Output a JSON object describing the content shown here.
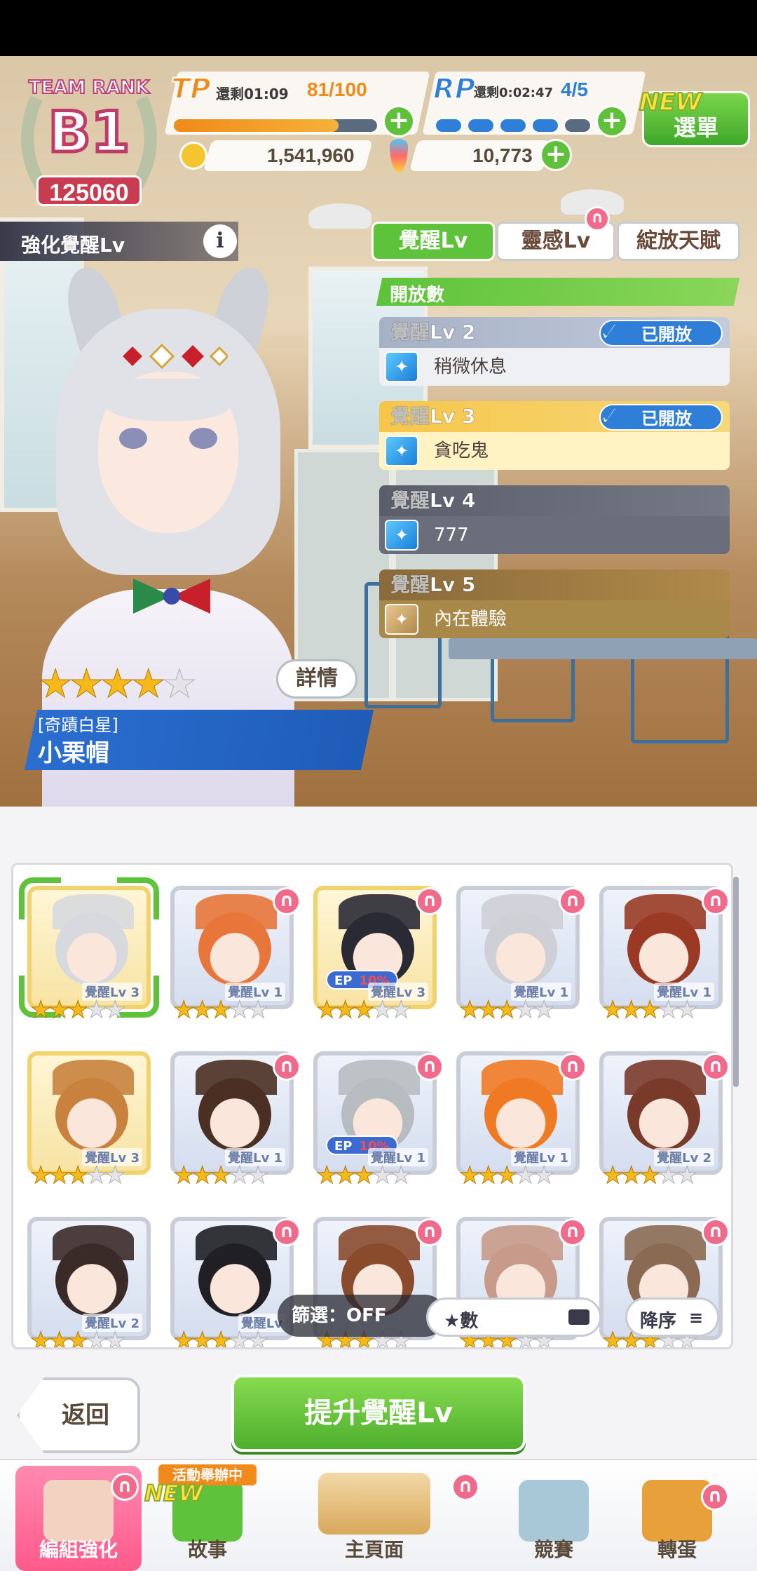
{
  "header": {
    "team_rank_label": "TEAM RANK",
    "rank_grade": "B1",
    "rank_points": "125060",
    "tp": {
      "label": "TP",
      "timer": "還剩01:09",
      "value": "81/100",
      "fill": 0.81
    },
    "rp": {
      "label": "RP",
      "timer": "還剩0:02:47",
      "value": "4/5",
      "filled_pips": 4,
      "total_pips": 5
    },
    "menu_new": "NEW",
    "menu_label": "選單",
    "coins": "1,541,960",
    "carrots": "10,773",
    "plus": "+"
  },
  "left_panel": {
    "title": "強化覺醒Lv",
    "info": "i",
    "details_button": "詳情",
    "character_title": "[奇蹟白星]",
    "character_name": "小栗帽",
    "stars": {
      "filled": 4,
      "total": 5
    }
  },
  "tabs": [
    {
      "label": "覺醒Lv",
      "active": true
    },
    {
      "label": "靈感Lv",
      "active": false
    },
    {
      "label": "綻放天賦",
      "active": false
    }
  ],
  "unlock_header": "開放數",
  "awakening_levels": [
    {
      "level": "覺醒Lv 2",
      "skill": "稍微休息",
      "status": "已開放",
      "style": "grey"
    },
    {
      "level": "覺醒Lv 3",
      "skill": "貪吃鬼",
      "status": "已開放",
      "style": "gold"
    },
    {
      "level": "覺醒Lv 4",
      "skill": "777",
      "status": "",
      "style": "dark"
    },
    {
      "level": "覺醒Lv 5",
      "skill": "內在體驗",
      "status": "",
      "style": "brown"
    }
  ],
  "roster": [
    {
      "label": "覺醒Lv 3",
      "stars": 3,
      "ep": "",
      "selected": true,
      "frame": "gold",
      "horseshoe": false,
      "hair": "#d7d9de"
    },
    {
      "label": "覺醒Lv 1",
      "stars": 3,
      "ep": "",
      "selected": false,
      "frame": "silver",
      "horseshoe": true,
      "hair": "#e8763a"
    },
    {
      "label": "覺醒Lv 3",
      "stars": 3,
      "ep": "10%",
      "selected": false,
      "frame": "gold",
      "horseshoe": true,
      "hair": "#2a2a35"
    },
    {
      "label": "覺醒Lv 1",
      "stars": 3,
      "ep": "",
      "selected": false,
      "frame": "silver",
      "horseshoe": true,
      "hair": "#cfcfd6"
    },
    {
      "label": "覺醒Lv 1",
      "stars": 3,
      "ep": "",
      "selected": false,
      "frame": "silver",
      "horseshoe": true,
      "hair": "#9a3a25"
    },
    {
      "label": "覺醒Lv 3",
      "stars": 3,
      "ep": "",
      "selected": false,
      "frame": "gold",
      "horseshoe": false,
      "hair": "#c8823e"
    },
    {
      "label": "覺醒Lv 1",
      "stars": 3,
      "ep": "",
      "selected": false,
      "frame": "silver",
      "horseshoe": true,
      "hair": "#4a2f22"
    },
    {
      "label": "覺醒Lv 1",
      "stars": 3,
      "ep": "10%",
      "selected": false,
      "frame": "silver",
      "horseshoe": true,
      "hair": "#b7bcc0"
    },
    {
      "label": "覺醒Lv 1",
      "stars": 3,
      "ep": "",
      "selected": false,
      "frame": "silver",
      "horseshoe": true,
      "hair": "#f07a24"
    },
    {
      "label": "覺醒Lv 2",
      "stars": 3,
      "ep": "",
      "selected": false,
      "frame": "silver",
      "horseshoe": true,
      "hair": "#7a3a2a"
    },
    {
      "label": "覺醒Lv 2",
      "stars": 3,
      "ep": "",
      "selected": false,
      "frame": "silver",
      "horseshoe": false,
      "hair": "#3a2a28"
    },
    {
      "label": "覺醒Lv",
      "stars": 3,
      "ep": "",
      "selected": false,
      "frame": "silver",
      "horseshoe": true,
      "hair": "#1f1f24"
    },
    {
      "label": "",
      "stars": 3,
      "ep": "",
      "selected": false,
      "frame": "silver",
      "horseshoe": true,
      "hair": "#8a4a2c"
    },
    {
      "label": "",
      "stars": 3,
      "ep": "",
      "selected": false,
      "frame": "silver",
      "horseshoe": true,
      "hair": "#c79a8a"
    },
    {
      "label": "",
      "stars": 3,
      "ep": "",
      "selected": false,
      "frame": "silver",
      "horseshoe": true,
      "hair": "#8a6a52"
    }
  ],
  "filter": {
    "label": "篩選：OFF",
    "sort_key": "★數",
    "order": "降序"
  },
  "buttons": {
    "back": "返回",
    "upgrade": "提升覺醒Lv"
  },
  "bottom_nav": [
    {
      "label": "編組強化",
      "active": true,
      "badge": ""
    },
    {
      "label": "故事",
      "active": false,
      "badge": "活動舉辦中",
      "new": "NEW"
    },
    {
      "label": "主頁面",
      "active": false,
      "badge": ""
    },
    {
      "label": "競賽",
      "active": false,
      "badge": ""
    },
    {
      "label": "轉蛋",
      "active": false,
      "badge": ""
    }
  ],
  "colors": {
    "accent_green": "#5ec33a",
    "accent_blue": "#2f7fd8",
    "rank_pink": "#c83c52"
  }
}
